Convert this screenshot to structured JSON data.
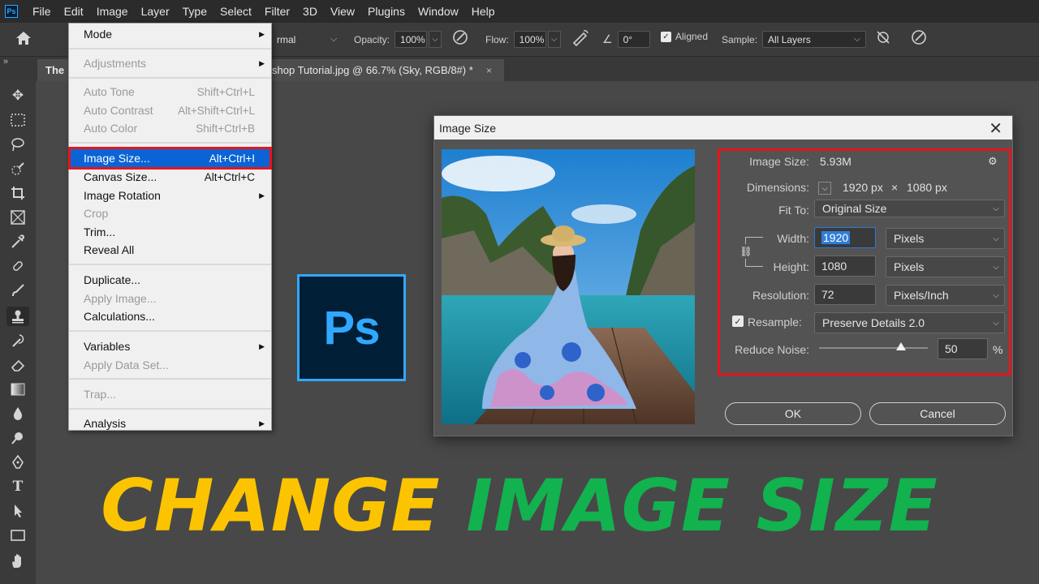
{
  "menubar": {
    "logo": "Ps",
    "items": [
      "File",
      "Edit",
      "Image",
      "Layer",
      "Type",
      "Select",
      "Filter",
      "3D",
      "View",
      "Plugins",
      "Window",
      "Help"
    ]
  },
  "options": {
    "mode_value": "rmal",
    "opacity_label": "Opacity:",
    "opacity_value": "100%",
    "flow_label": "Flow:",
    "flow_value": "100%",
    "angle_value": "0°",
    "aligned_label": "Aligned",
    "sample_label": "Sample:",
    "sample_value": "All Layers"
  },
  "tabs": {
    "collapse": "»",
    "doc_start": "The",
    "doc_end": "shop Tutorial.jpg @ 66.7% (Sky, RGB/8#) *",
    "close": "×"
  },
  "image_menu": {
    "mode": "Mode",
    "adjustments": "Adjustments",
    "auto_tone": "Auto Tone",
    "auto_tone_sc": "Shift+Ctrl+L",
    "auto_contrast": "Auto Contrast",
    "auto_contrast_sc": "Alt+Shift+Ctrl+L",
    "auto_color": "Auto Color",
    "auto_color_sc": "Shift+Ctrl+B",
    "image_size": "Image Size...",
    "image_size_sc": "Alt+Ctrl+I",
    "canvas_size": "Canvas Size...",
    "canvas_size_sc": "Alt+Ctrl+C",
    "image_rotation": "Image Rotation",
    "crop": "Crop",
    "trim": "Trim...",
    "reveal_all": "Reveal All",
    "duplicate": "Duplicate...",
    "apply_image": "Apply Image...",
    "calculations": "Calculations...",
    "variables": "Variables",
    "apply_data_set": "Apply Data Set...",
    "trap": "Trap...",
    "analysis": "Analysis"
  },
  "big_logo": "Ps",
  "dialog": {
    "title": "Image Size",
    "close": "✕",
    "image_size_label": "Image Size:",
    "image_size_value": "5.93M",
    "dimensions_label": "Dimensions:",
    "dim_width": "1920 px",
    "dim_x": "×",
    "dim_height": "1080 px",
    "fit_to_label": "Fit To:",
    "fit_to_value": "Original Size",
    "width_label": "Width:",
    "width_value": "1920",
    "width_unit": "Pixels",
    "height_label": "Height:",
    "height_value": "1080",
    "height_unit": "Pixels",
    "resolution_label": "Resolution:",
    "resolution_value": "72",
    "resolution_unit": "Pixels/Inch",
    "resample_label": "Resample:",
    "resample_checked": true,
    "resample_value": "Preserve Details 2.0",
    "reduce_noise_label": "Reduce Noise:",
    "reduce_noise_value": "50",
    "reduce_noise_unit": "%",
    "reduce_noise_fraction": 0.5,
    "ok": "OK",
    "cancel": "Cancel"
  },
  "caption": {
    "word1": "CHANGE",
    "word2": "IMAGE SIZE"
  },
  "colors": {
    "highlight_box": "#e8141b",
    "menu_highlight": "#0a64d6",
    "ps_blue": "#31a8ff",
    "caption_yellow": "#fcc400",
    "caption_green": "#12b24f"
  }
}
